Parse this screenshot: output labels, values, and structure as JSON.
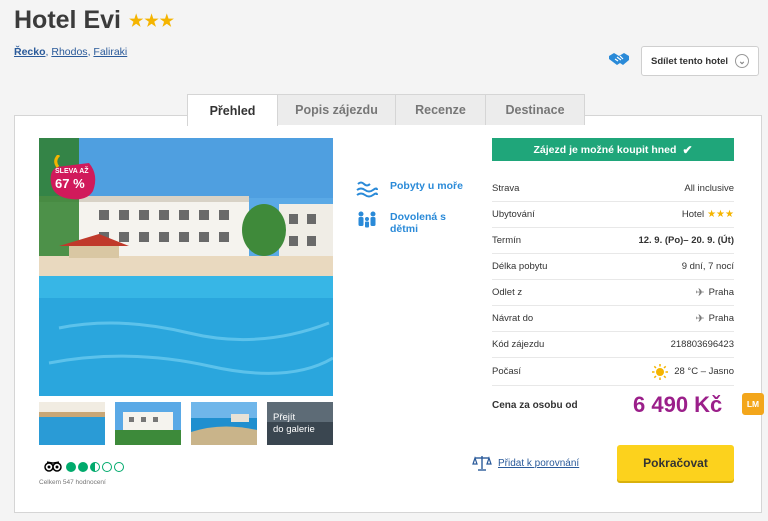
{
  "hotel": {
    "name": "Hotel Evi",
    "stars": "★★★"
  },
  "breadcrumb": [
    {
      "label": "Řecko"
    },
    {
      "label": "Rhodos"
    },
    {
      "label": "Faliraki"
    }
  ],
  "share": {
    "label": "Sdílet tento hotel",
    "icon": "chevron-down-icon"
  },
  "tabs": [
    {
      "label": "Přehled",
      "active": true
    },
    {
      "label": "Popis zájezdu"
    },
    {
      "label": "Recenze"
    },
    {
      "label": "Destinace"
    }
  ],
  "sale": {
    "line1": "SLEVA AŽ",
    "line2": "67 %"
  },
  "gallery": {
    "line1": "Přejít",
    "line2": "do galerie"
  },
  "rating": {
    "bubbles": 2.5,
    "count_text": "Celkem 547 hodnocení"
  },
  "features": [
    {
      "label": "Pobyty u moře",
      "icon": "beach-wave-icon"
    },
    {
      "label": "Dovolená s dětmi",
      "icon": "family-icon"
    }
  ],
  "buy_banner": {
    "label": "Zájezd je možné koupit hned",
    "icon": "check-icon"
  },
  "info": {
    "strava": {
      "k": "Strava",
      "v": "All inclusive"
    },
    "ubytovani": {
      "k": "Ubytování",
      "v": "Hotel",
      "stars": "★★★"
    },
    "termin": {
      "k": "Termín",
      "v": "12. 9. (Po)– 20. 9. (Út)"
    },
    "delka": {
      "k": "Délka pobytu",
      "v": "9 dní, 7 nocí"
    },
    "odlet": {
      "k": "Odlet z",
      "v": "Praha"
    },
    "navrat": {
      "k": "Návrat do",
      "v": "Praha"
    },
    "kod": {
      "k": "Kód zájezdu",
      "v": "218803696423"
    },
    "pocasi": {
      "k": "Počasí",
      "v": "28 °C – Jasno"
    }
  },
  "price": {
    "label": "Cena za osobu od",
    "value": "6 490 Kč",
    "badge": "LM"
  },
  "compare": {
    "label": "Přidat k porovnání"
  },
  "continue": {
    "label": "Pokračovat"
  },
  "colors": {
    "accent_blue": "#2a8ad8",
    "green": "#1fa67a",
    "price_purple": "#9b1f8a",
    "button_yellow": "#fcd21d",
    "badge_orange": "#f3a61b"
  }
}
